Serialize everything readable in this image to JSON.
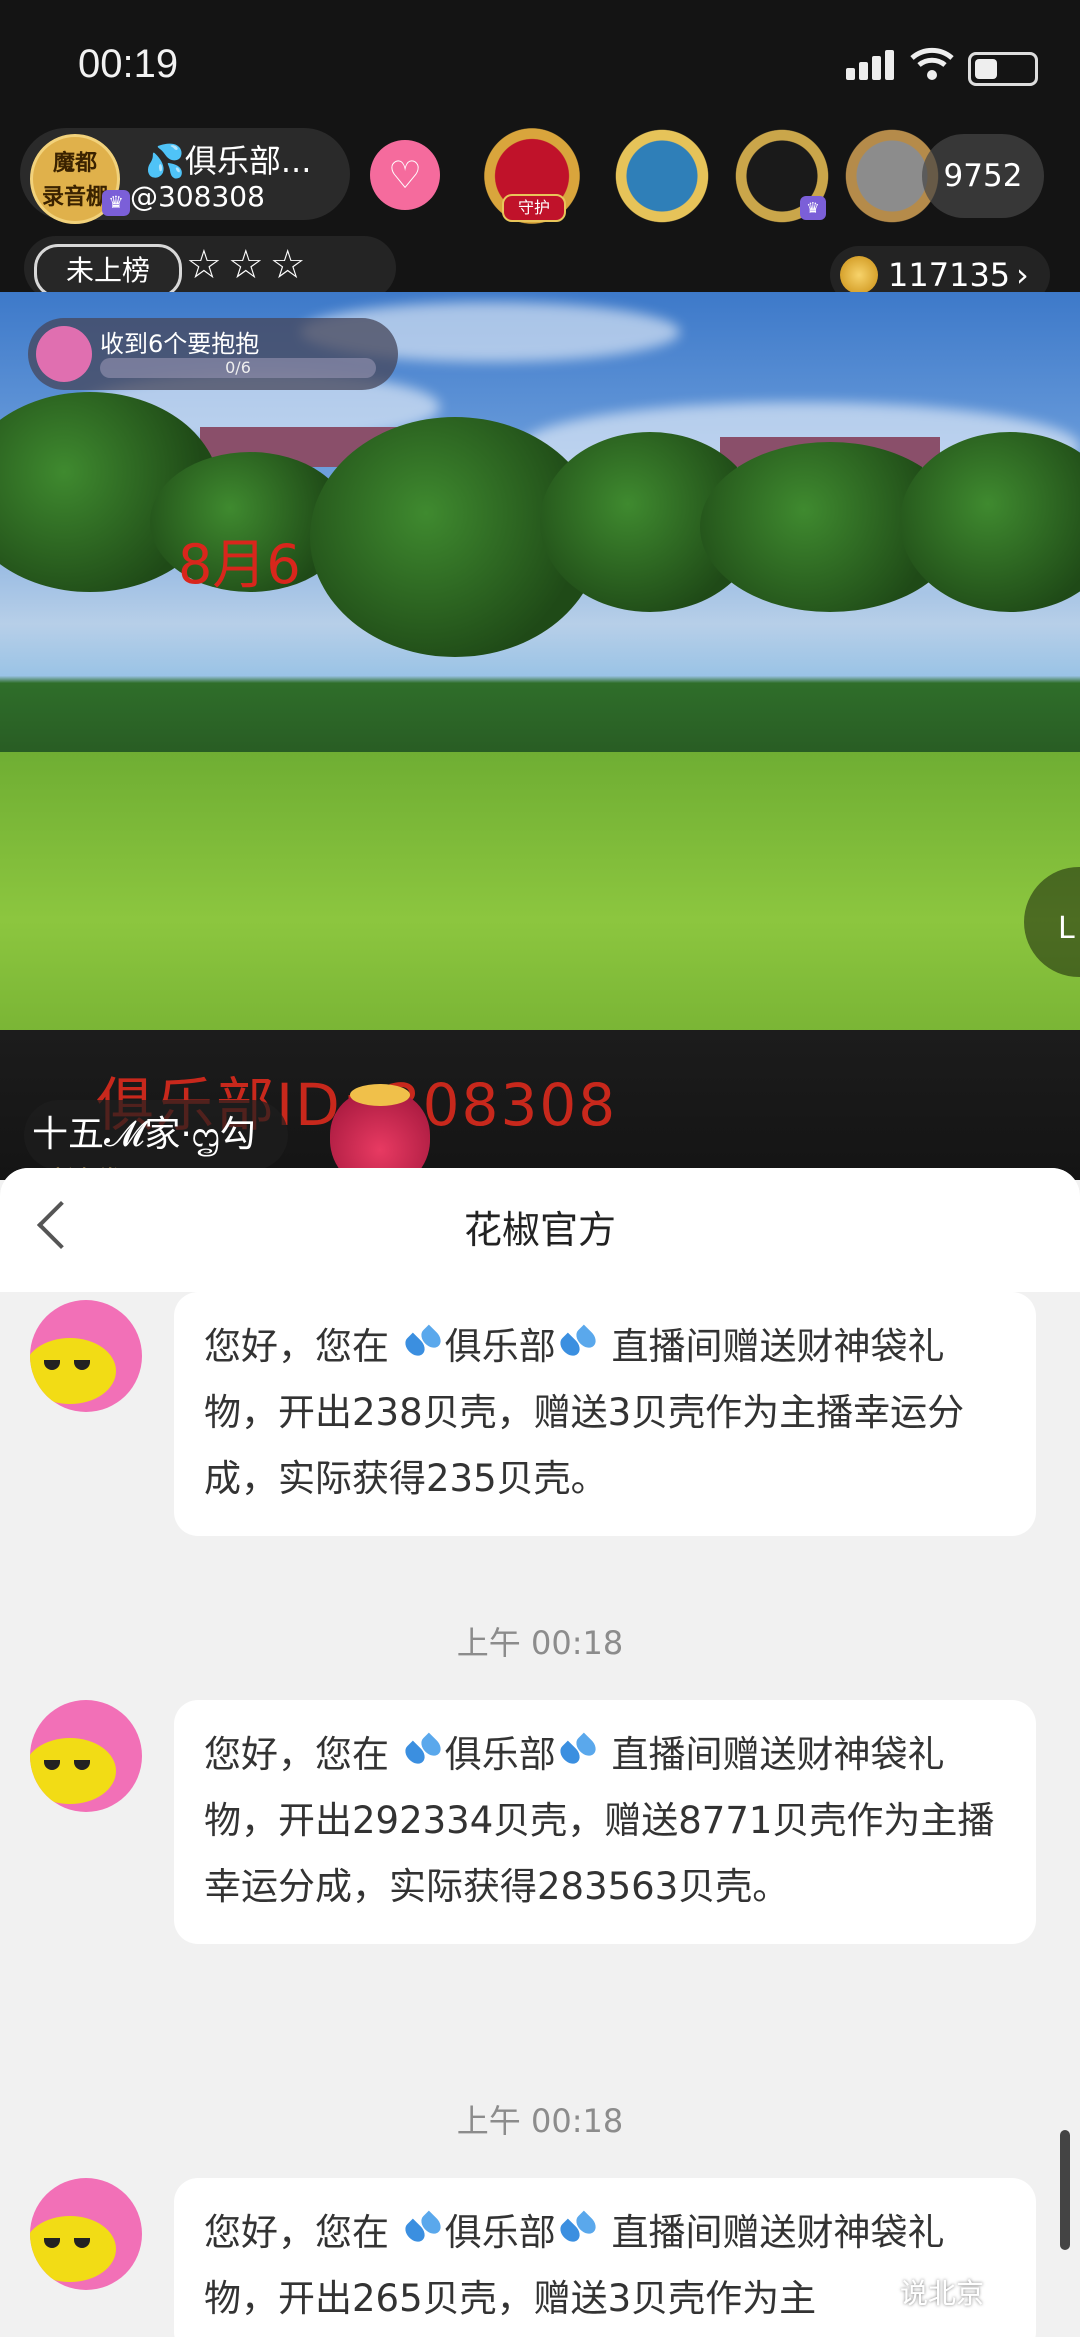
{
  "status_bar": {
    "time": "00:19"
  },
  "live_room": {
    "host_avatar_text_1": "魔都",
    "host_avatar_text_2": "录音棚",
    "host_name": "💦俱乐部...",
    "host_id": "@308308",
    "guard_badge_label": "守护",
    "viewer_count": "9752",
    "rank_label": "未上榜",
    "stars": "☆☆☆",
    "coin_count": "117135",
    "task_title": "收到6个要抱抱",
    "task_progress_text": "0/6",
    "task_progress_fraction": 0,
    "video_date_text": "8月6",
    "video_caption": "俱乐部ID: 308308",
    "edge_button_label": "L",
    "viewer_nickname": "十五𝓜家·ᦗ勾",
    "viewer_subtitle": "财神袋"
  },
  "chat_panel": {
    "title": "花椒官方",
    "messages": [
      {
        "text_prefix": "您好，您在 ",
        "club": "俱乐部",
        "text_rest": " 直播间赠送财神袋礼物，开出238贝壳，赠送3贝壳作为主播幸运分成，实际获得235贝壳。"
      },
      {
        "timestamp": "上午 00:18",
        "text_prefix": "您好，您在 ",
        "club": "俱乐部",
        "text_rest": " 直播间赠送财神袋礼物，开出292334贝壳，赠送8771贝壳作为主播幸运分成，实际获得283563贝壳。"
      },
      {
        "timestamp": "上午 00:18",
        "text_prefix": "您好，您在 ",
        "club": "俱乐部",
        "text_rest": " 直播间赠送财神袋礼物，开出265贝壳，赠送3贝壳作为主"
      }
    ]
  },
  "watermark": "说北京",
  "colors": {
    "accent_pink": "#f56b9d",
    "caption_red": "#c8281c",
    "avatar_pink": "#f270b7"
  }
}
